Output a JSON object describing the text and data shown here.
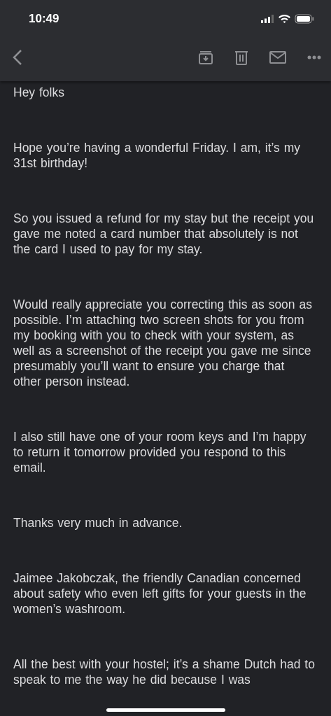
{
  "status_bar": {
    "time": "10:49"
  },
  "toolbar": {
    "actions": [
      {
        "kind": "archive"
      },
      {
        "kind": "trash"
      },
      {
        "kind": "mail"
      },
      {
        "kind": "more"
      }
    ]
  },
  "message": {
    "paragraphs": [
      "Hey folks",
      "Hope you’re having a wonderful Friday. I am, it’s my 31st birthday!",
      "So you issued a refund for my stay but the receipt you gave me noted a card number that absolutely is not the card I used to pay for my stay.",
      "Would really appreciate you correcting this as soon as possible. I’m attaching two screen shots for you from my booking with you to check with your system, as well as a screenshot of the receipt you gave me since presumably you’ll want to ensure you charge that other person instead.",
      "I also still have one of your room keys and I’m happy to return it tomorrow provided you respond to this email.",
      "Thanks very much in advance.",
      "Jaimee Jakobczak, the friendly Canadian concerned about safety who even left gifts for your guests in the women’s washroom.",
      "All the best with your hostel; it’s a shame Dutch had to speak to me the way he did because I was"
    ]
  }
}
